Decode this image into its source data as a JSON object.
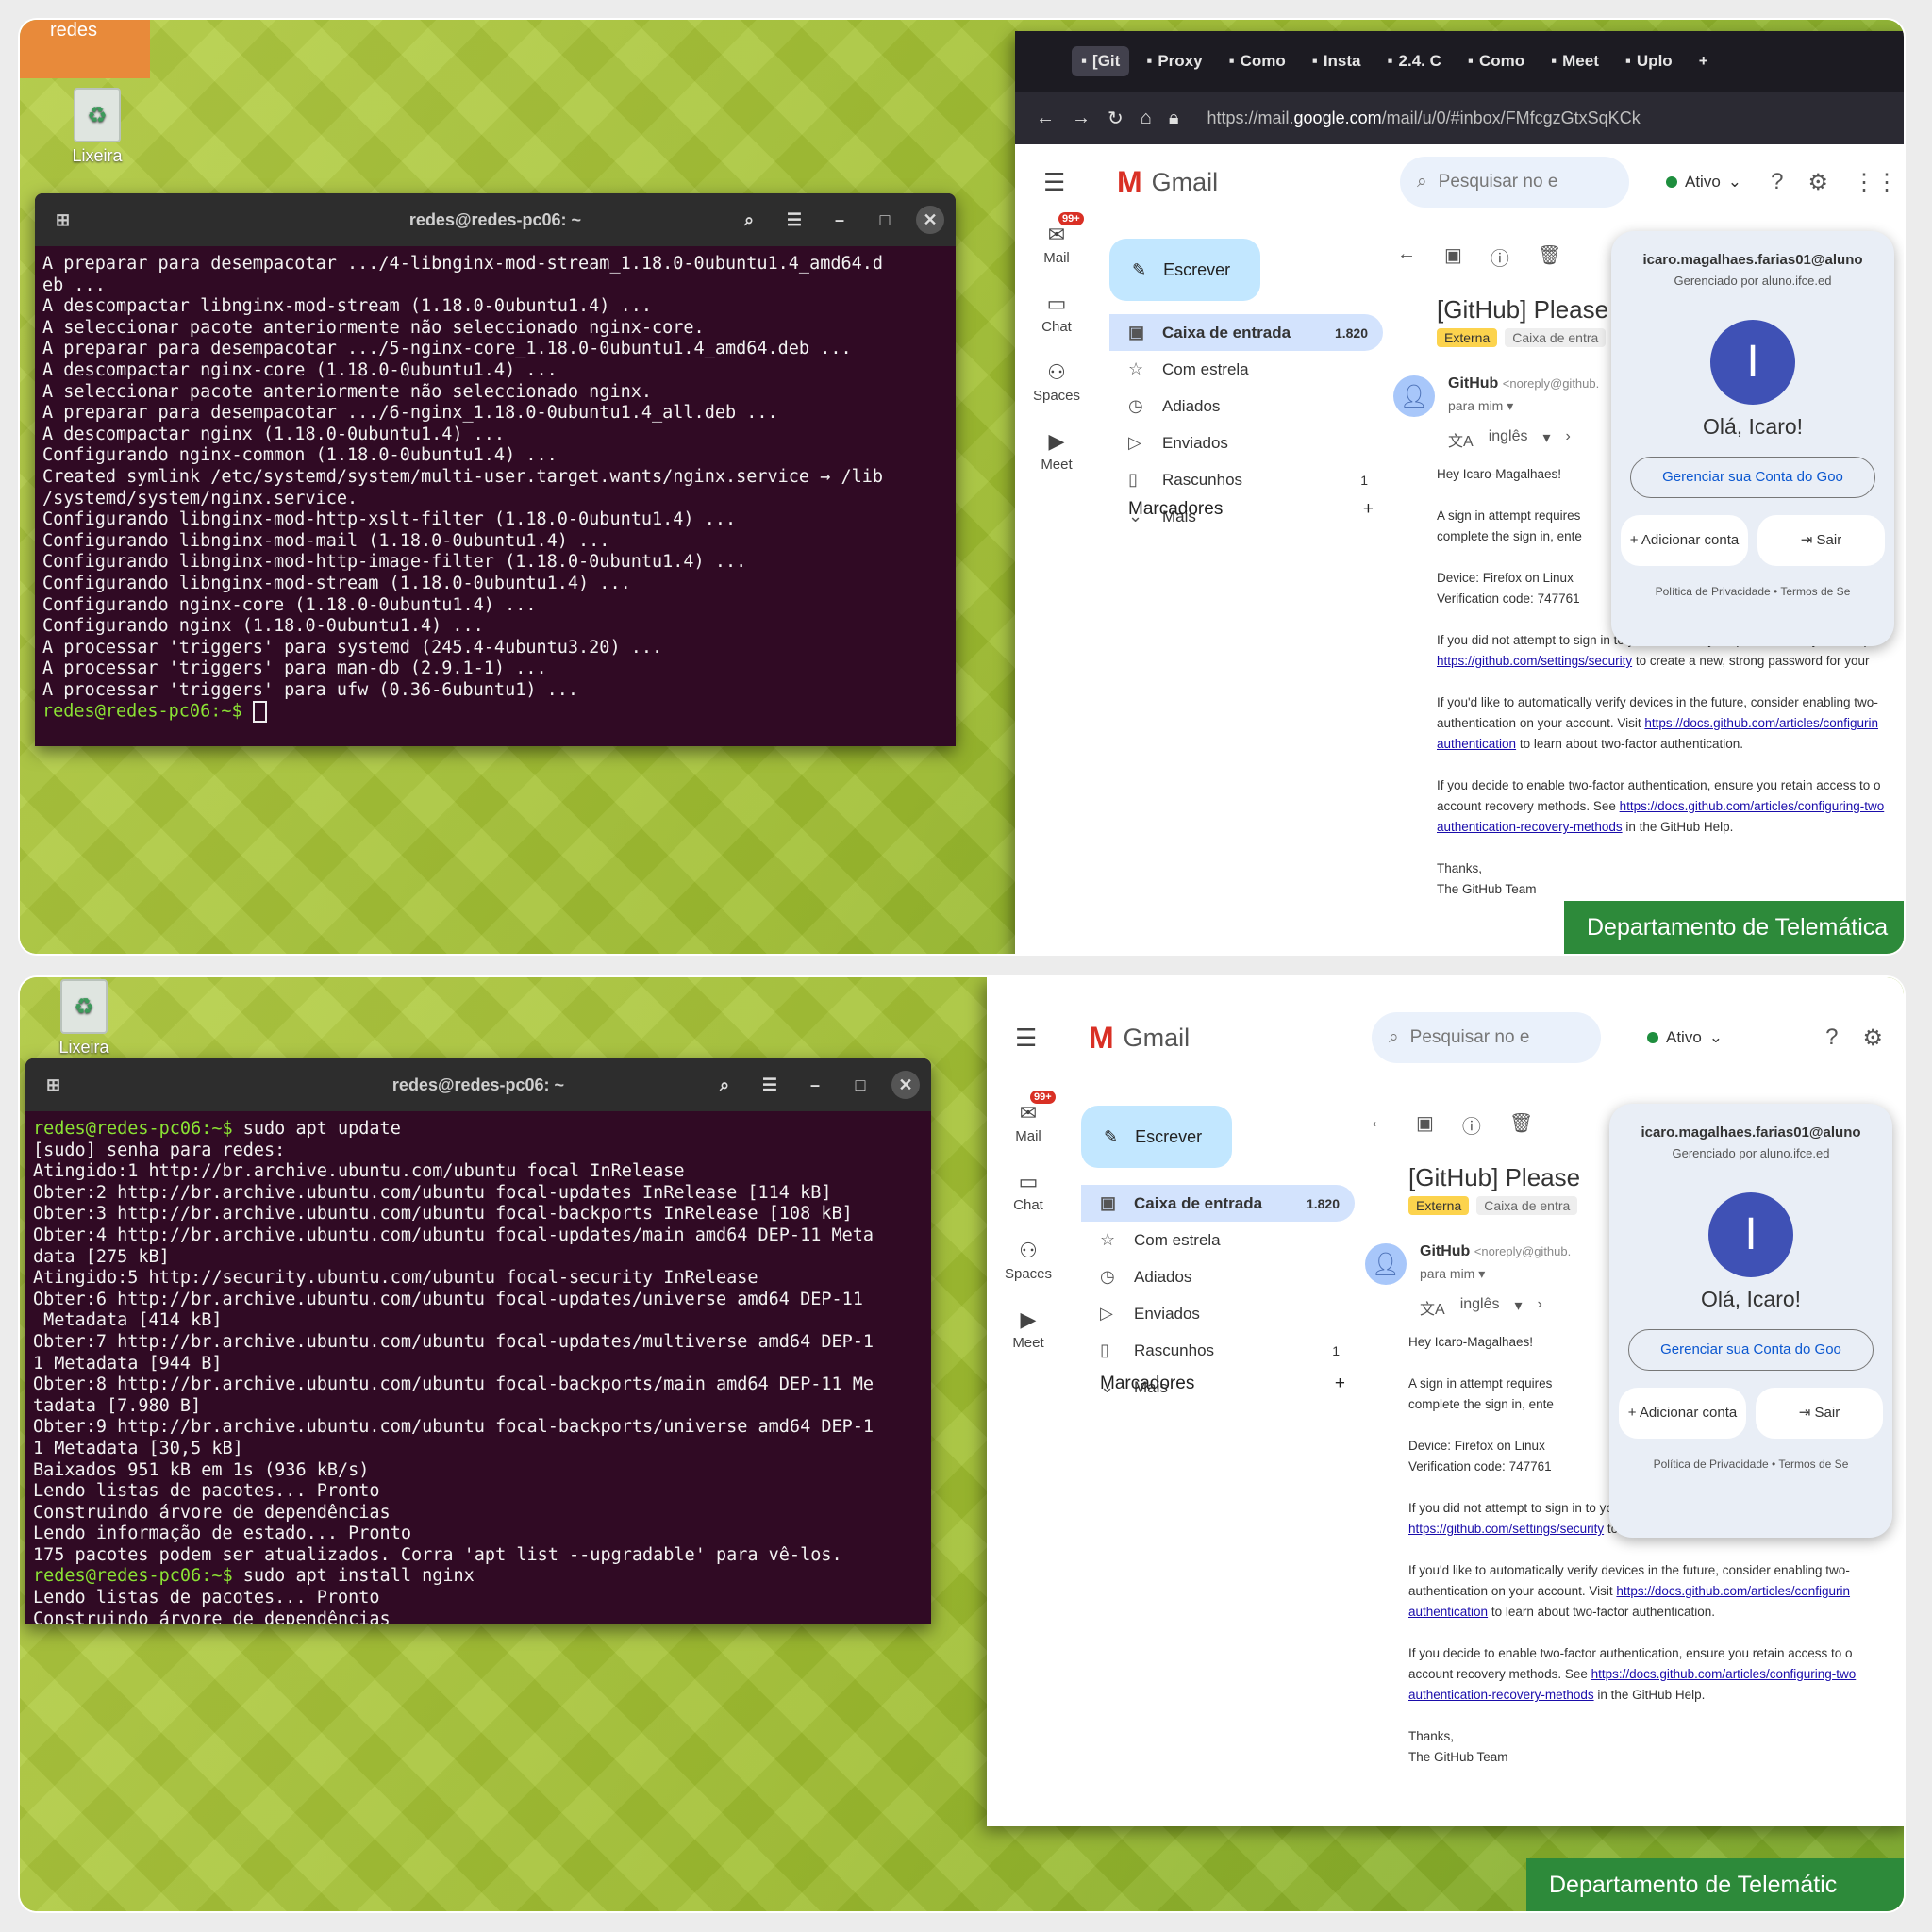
{
  "desktop": {
    "user_label": "redes",
    "trash_label": "Lixeira",
    "dept_label": "Departamento de Telemática",
    "dept_label_2": "Departamento de Telemátic"
  },
  "terminal": {
    "title": "redes@redes-pc06: ~",
    "top_lines": [
      "A preparar para desempacotar .../4-libnginx-mod-stream_1.18.0-0ubuntu1.4_amd64.d",
      "eb ...",
      "A descompactar libnginx-mod-stream (1.18.0-0ubuntu1.4) ...",
      "A seleccionar pacote anteriormente não seleccionado nginx-core.",
      "A preparar para desempacotar .../5-nginx-core_1.18.0-0ubuntu1.4_amd64.deb ...",
      "A descompactar nginx-core (1.18.0-0ubuntu1.4) ...",
      "A seleccionar pacote anteriormente não seleccionado nginx.",
      "A preparar para desempacotar .../6-nginx_1.18.0-0ubuntu1.4_all.deb ...",
      "A descompactar nginx (1.18.0-0ubuntu1.4) ...",
      "Configurando nginx-common (1.18.0-0ubuntu1.4) ...",
      "Created symlink /etc/systemd/system/multi-user.target.wants/nginx.service → /lib",
      "/systemd/system/nginx.service.",
      "Configurando libnginx-mod-http-xslt-filter (1.18.0-0ubuntu1.4) ...",
      "Configurando libnginx-mod-mail (1.18.0-0ubuntu1.4) ...",
      "Configurando libnginx-mod-http-image-filter (1.18.0-0ubuntu1.4) ...",
      "Configurando libnginx-mod-stream (1.18.0-0ubuntu1.4) ...",
      "Configurando nginx-core (1.18.0-0ubuntu1.4) ...",
      "Configurando nginx (1.18.0-0ubuntu1.4) ...",
      "A processar 'triggers' para systemd (245.4-4ubuntu3.20) ...",
      "A processar 'triggers' para man-db (2.9.1-1) ...",
      "A processar 'triggers' para ufw (0.36-6ubuntu1) ..."
    ],
    "prompt": "redes@redes-pc06",
    "prompt_suffix": ":~$ ",
    "cmd_update": "sudo apt update",
    "cmd_install": "sudo apt install nginx",
    "bottom_lines": [
      "[sudo] senha para redes:",
      "Atingido:1 http://br.archive.ubuntu.com/ubuntu focal InRelease",
      "Obter:2 http://br.archive.ubuntu.com/ubuntu focal-updates InRelease [114 kB]",
      "Obter:3 http://br.archive.ubuntu.com/ubuntu focal-backports InRelease [108 kB]",
      "Obter:4 http://br.archive.ubuntu.com/ubuntu focal-updates/main amd64 DEP-11 Meta",
      "data [275 kB]",
      "Atingido:5 http://security.ubuntu.com/ubuntu focal-security InRelease",
      "Obter:6 http://br.archive.ubuntu.com/ubuntu focal-updates/universe amd64 DEP-11",
      " Metadata [414 kB]",
      "Obter:7 http://br.archive.ubuntu.com/ubuntu focal-updates/multiverse amd64 DEP-1",
      "1 Metadata [944 B]",
      "Obter:8 http://br.archive.ubuntu.com/ubuntu focal-backports/main amd64 DEP-11 Me",
      "tadata [7.980 B]",
      "Obter:9 http://br.archive.ubuntu.com/ubuntu focal-backports/universe amd64 DEP-1",
      "1 Metadata [30,5 kB]",
      "Baixados 951 kB em 1s (936 kB/s)",
      "Lendo listas de pacotes... Pronto",
      "Construindo árvore de dependências",
      "Lendo informação de estado... Pronto",
      "175 pacotes podem ser atualizados. Corra 'apt list --upgradable' para vê-los."
    ],
    "after_install_lines": [
      "Lendo listas de pacotes... Pronto",
      "Construindo árvore de dependências"
    ]
  },
  "browser": {
    "tabs": [
      "[Git",
      "Proxy",
      "Como",
      "Insta",
      "2.4. C",
      "Como",
      "Meet",
      "Uplo"
    ],
    "url_prefix": "https://mail.",
    "url_domain": "google.com",
    "url_rest": "/mail/u/0/#inbox/FMfcgzGtxSqKCk"
  },
  "gmail": {
    "logo": "Gmail",
    "search_placeholder": "Pesquisar no e",
    "status": "Ativo",
    "rail": [
      {
        "label": "Mail",
        "icon": "✉",
        "badge": "99+"
      },
      {
        "label": "Chat",
        "icon": "▭",
        "badge": ""
      },
      {
        "label": "Spaces",
        "icon": "⚇",
        "badge": ""
      },
      {
        "label": "Meet",
        "icon": "▶",
        "badge": ""
      }
    ],
    "compose": "Escrever",
    "nav": [
      {
        "label": "Caixa de entrada",
        "count": "1.820",
        "icon": "▣"
      },
      {
        "label": "Com estrela",
        "count": "",
        "icon": "☆"
      },
      {
        "label": "Adiados",
        "count": "",
        "icon": "◷"
      },
      {
        "label": "Enviados",
        "count": "",
        "icon": "▷"
      },
      {
        "label": "Rascunhos",
        "count": "1",
        "icon": "▯"
      },
      {
        "label": "Mais",
        "count": "",
        "icon": "⌄"
      }
    ],
    "labels_heading": "Marcadores",
    "subject": "[GitHub] Please",
    "chip_external": "Externa",
    "chip_inbox": "Caixa de entra",
    "sender_name": "GitHub",
    "sender_email": "<noreply@github.",
    "to": "para mim",
    "translate": "inglês",
    "body": [
      "Hey Icaro-Magalhaes!",
      "A sign in attempt requires",
      "complete the sign in, ente",
      "Device: Firefox on Linux",
      "Verification code: 747761",
      "If you did not attempt to sign in to your account, your password may be compr",
      "to create a new, strong password for your",
      "If you'd like to automatically verify devices in the future, consider enabling two-",
      "authentication on your account. Visit",
      "to learn about two-factor authentication.",
      "If you decide to enable two-factor authentication, ensure you retain access to o",
      "account recovery methods. See",
      "in the GitHub Help.",
      "Thanks,",
      "The GitHub Team"
    ],
    "links": [
      "https://github.com/settings/security",
      "https://docs.github.com/articles/configurin",
      "authentication",
      "https://docs.github.com/articles/configuring-two",
      "authentication-recovery-methods"
    ],
    "account": {
      "email": "icaro.magalhaes.farias01@aluno",
      "managed": "Gerenciado por aluno.ifce.ed",
      "initial": "I",
      "greeting": "Olá, Icaro!",
      "manage": "Gerenciar sua Conta do Goo",
      "add": "Adicionar conta",
      "logout": "Sair",
      "footer": "Política de Privacidade  •  Termos de Se"
    }
  },
  "colors": {
    "terminal_bg": "#300a24",
    "prompt": "#8ae234",
    "gmail_selected": "#d3e3fd",
    "compose": "#c2e7ff",
    "desktop_green": "#a9c53d"
  }
}
